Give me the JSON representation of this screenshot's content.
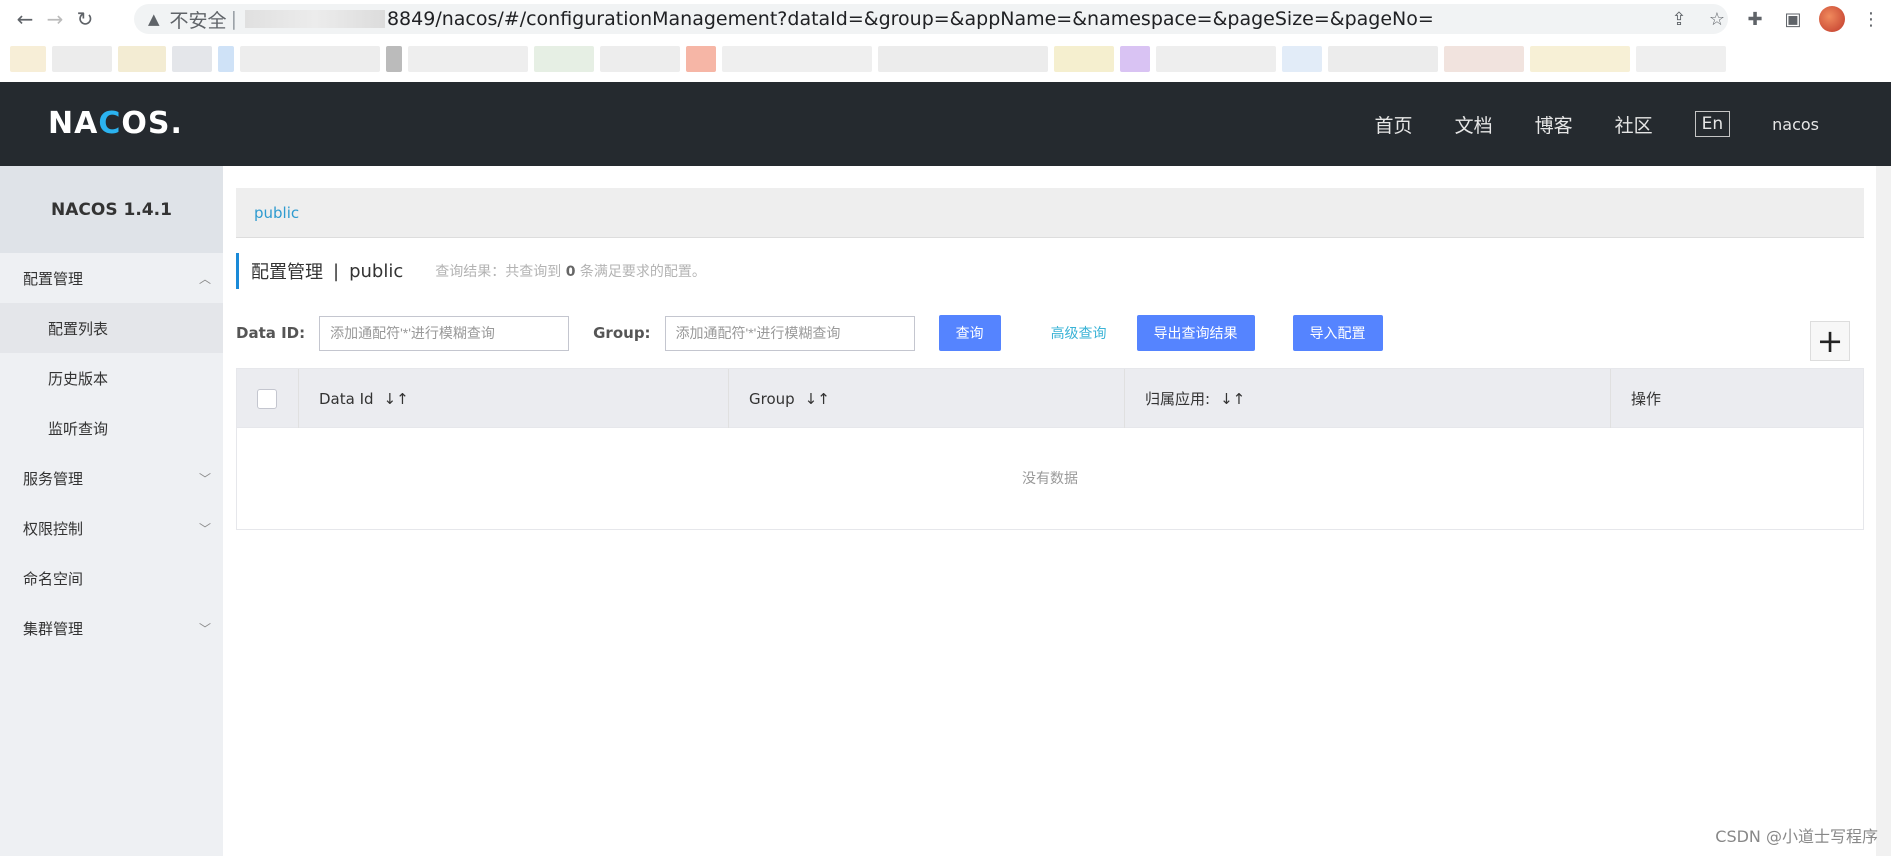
{
  "browser": {
    "insecure_label": "不安全",
    "url": "8849/nacos/#/configurationManagement?dataId=&group=&appName=&namespace=&pageSize=&pageNo="
  },
  "header": {
    "logo": "NACOS.",
    "nav": [
      "首页",
      "文档",
      "博客",
      "社区"
    ],
    "lang": "En",
    "user": "nacos"
  },
  "sidebar": {
    "title": "NACOS 1.4.1",
    "items": [
      {
        "label": "配置管理",
        "chevron": "up"
      },
      {
        "label": "配置列表",
        "sub": true,
        "active": true
      },
      {
        "label": "历史版本",
        "sub": true
      },
      {
        "label": "监听查询",
        "sub": true
      },
      {
        "label": "服务管理",
        "chevron": "down"
      },
      {
        "label": "权限控制",
        "chevron": "down"
      },
      {
        "label": "命名空间"
      },
      {
        "label": "集群管理",
        "chevron": "down"
      }
    ]
  },
  "main": {
    "namespace_tab": "public",
    "heading": {
      "title": "配置管理",
      "sep": "|",
      "namespace": "public"
    },
    "result": {
      "prefix": "查询结果：共查询到",
      "count": "0",
      "suffix": "条满足要求的配置。"
    },
    "form": {
      "dataid_label": "Data ID:",
      "dataid_placeholder": "添加通配符'*'进行模糊查询",
      "group_label": "Group:",
      "group_placeholder": "添加通配符'*'进行模糊查询",
      "query_btn": "查询",
      "advanced_link": "高级查询",
      "export_btn": "导出查询结果",
      "import_btn": "导入配置"
    },
    "table": {
      "columns": [
        "Data Id",
        "Group",
        "归属应用:",
        "操作"
      ],
      "empty": "没有数据"
    }
  },
  "watermark": "CSDN @小道士写程序"
}
